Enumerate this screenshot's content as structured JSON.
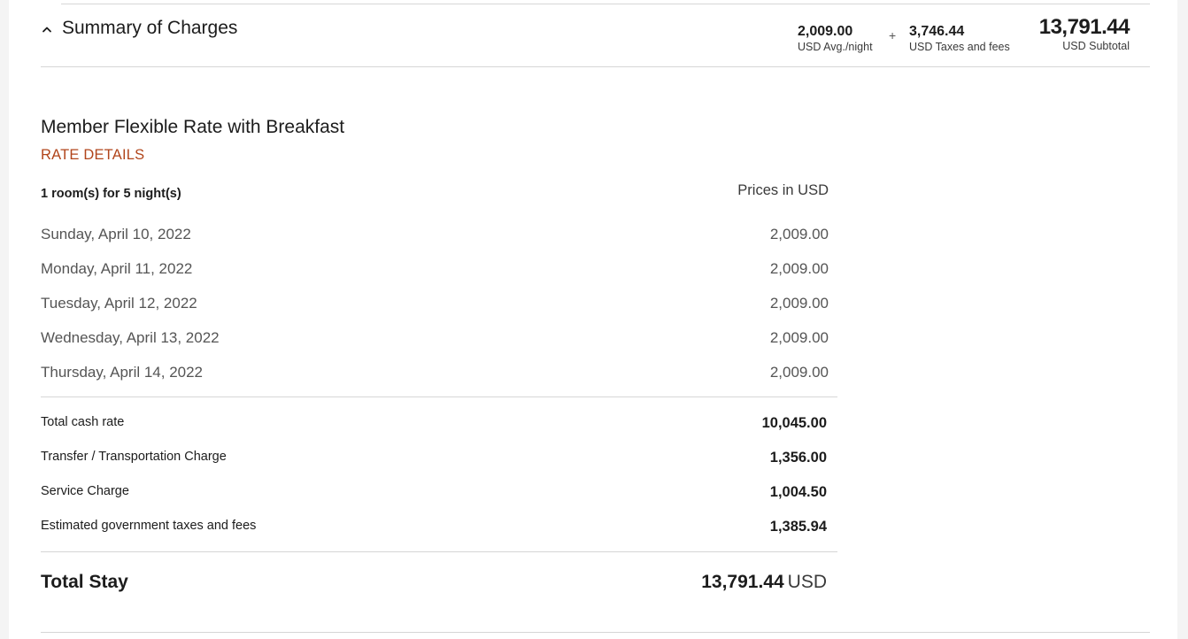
{
  "summary": {
    "title": "Summary of Charges",
    "avg_night_value": "2,009.00",
    "avg_night_label": "USD Avg./night",
    "plus_sign": "+",
    "taxes_value": "3,746.44",
    "taxes_label": "USD Taxes and fees",
    "subtotal_value": "13,791.44",
    "subtotal_label": "USD Subtotal"
  },
  "rate": {
    "name": "Member Flexible Rate with Breakfast",
    "details_link": "RATE DETAILS",
    "rooms_nights": "1 room(s) for 5 night(s)",
    "prices_currency": "Prices in USD",
    "nights": [
      {
        "date": "Sunday, April 10, 2022",
        "amount": "2,009.00"
      },
      {
        "date": "Monday, April 11, 2022",
        "amount": "2,009.00"
      },
      {
        "date": "Tuesday, April 12, 2022",
        "amount": "2,009.00"
      },
      {
        "date": "Wednesday, April 13, 2022",
        "amount": "2,009.00"
      },
      {
        "date": "Thursday, April 14, 2022",
        "amount": "2,009.00"
      }
    ],
    "charges": [
      {
        "label": "Total cash rate",
        "amount": "10,045.00"
      },
      {
        "label": "Transfer / Transportation Charge",
        "amount": "1,356.00"
      },
      {
        "label": "Service Charge",
        "amount": "1,004.50"
      },
      {
        "label": "Estimated government taxes and fees",
        "amount": "1,385.94"
      }
    ]
  },
  "total": {
    "label": "Total Stay",
    "amount": "13,791.44",
    "currency": "USD"
  },
  "icons": {
    "toggle": "chevron-up-icon"
  }
}
